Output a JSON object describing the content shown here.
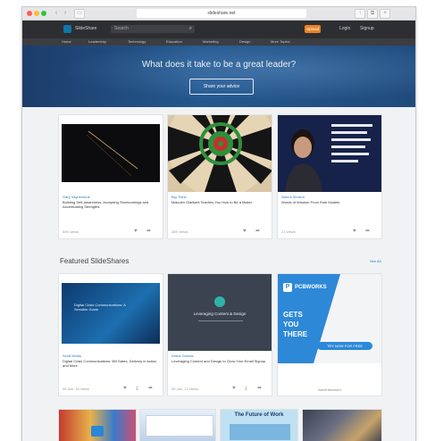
{
  "browser": {
    "address": "slideshare.net"
  },
  "topnav": {
    "logo_text": "SlideShare",
    "search_placeholder": "Search",
    "upload": "Upload",
    "login": "Login",
    "signup": "Signup"
  },
  "subnav": [
    "Home",
    "Leadership",
    "Technology",
    "Education",
    "Marketing",
    "Design",
    "More Topics"
  ],
  "hero": {
    "title": "What does it take to be a great leader?",
    "button": "Share your advice"
  },
  "row1": [
    {
      "author": "Gary Vaynerchuk",
      "title": "Building Self-Awareness, Accepting Shortcomings and Accentuating Strengths",
      "views": "50K views"
    },
    {
      "author": "Big Think",
      "title": "Malcolm Gladwell Teaches You How to Be a Maker",
      "views": "26K views"
    },
    {
      "author": "Naomi Simson",
      "title": "Words of Wisdom From Role Models",
      "views": "21 views"
    }
  ],
  "featured": {
    "heading": "Featured SlideShares",
    "see_all": "See All"
  },
  "row2": [
    {
      "thumb_text": "Digital Crisis Communications: A Sensible Guide",
      "author": "Scott Monty",
      "title": "Digital Crisis Communications: Bill Gates, Delivery in Action and More",
      "date": "05 Jan, 16 views"
    },
    {
      "thumb_text": "Leveraging Content & Design",
      "author": "Defne Graves",
      "title": "Leveraging Content and Design to Grow Your Email Signup",
      "date": "05 Jan, 13 views"
    }
  ],
  "ad": {
    "brand": "PCBWORKS",
    "headline": "GETS YOU THERE",
    "cta": "TRY NOW FOR FREE",
    "label": "Advertisement"
  },
  "row3": [
    {
      "thumb_text": ""
    },
    {
      "thumb_text": ""
    },
    {
      "thumb_text": "The Future of Work"
    },
    {
      "thumb_text": ""
    }
  ],
  "colors": {
    "accent": "#e98325",
    "link": "#2c79bf",
    "hero": "#24588f"
  }
}
